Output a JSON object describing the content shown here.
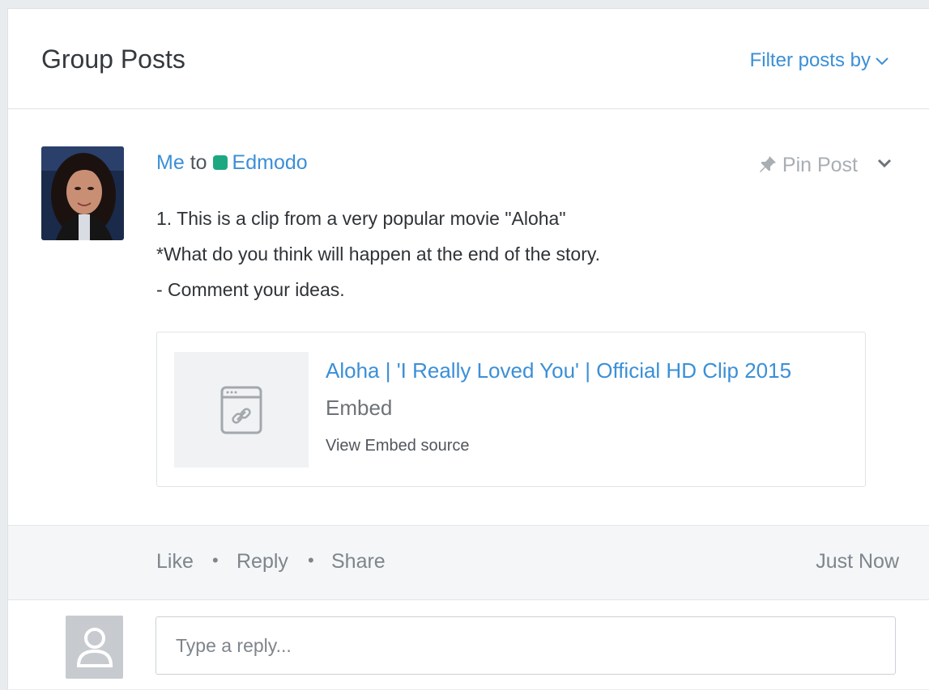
{
  "header": {
    "title": "Group Posts",
    "filter_label": "Filter posts by"
  },
  "post": {
    "author": "Me",
    "to_word": "to",
    "group": "Edmodo",
    "group_color": "#1ea881",
    "pin_label": "Pin Post",
    "lines": [
      "1. This is a clip from a very popular movie \"Aloha\"",
      "*What do you think will happen at the end of the story.",
      "- Comment your ideas."
    ],
    "embed": {
      "title": "Aloha | 'I Really Loved You' | Official HD Clip 2015",
      "type": "Embed",
      "source_link": "View Embed source",
      "icon": "embed-link-icon"
    }
  },
  "actions": {
    "like": "Like",
    "reply": "Reply",
    "share": "Share",
    "separator": "•",
    "timestamp": "Just Now"
  },
  "reply_box": {
    "placeholder": "Type a reply...",
    "value": ""
  },
  "colors": {
    "link": "#3b8fd6",
    "muted": "#7f858b"
  }
}
